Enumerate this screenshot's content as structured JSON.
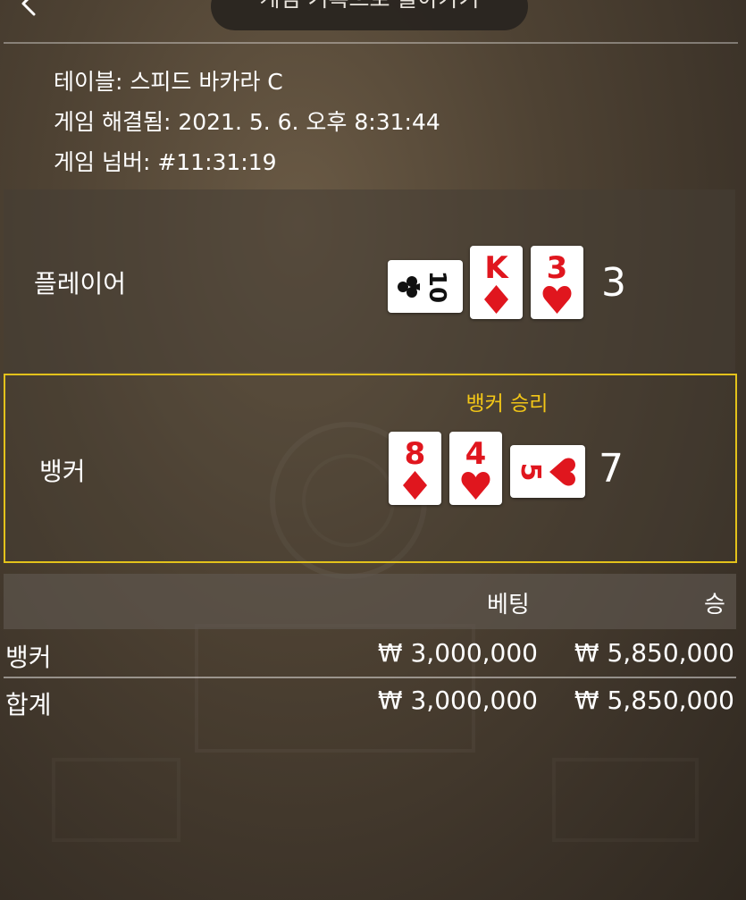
{
  "header": {
    "back_icon": "chevron-left-icon",
    "history_button_label": "게임 기록으로 돌아가기"
  },
  "info": {
    "table": "테이블: 스피드 바카라 C",
    "resolved": "게임 해결됨: 2021. 5. 6. 오후 8:31:44",
    "number": "게임 넘버: #11:31:19"
  },
  "player": {
    "label": "플레이어",
    "score": "3",
    "cards": [
      {
        "rank": "10",
        "suit": "clubs",
        "orientation": "rotated"
      },
      {
        "rank": "K",
        "suit": "diamonds",
        "orientation": "upright"
      },
      {
        "rank": "3",
        "suit": "hearts",
        "orientation": "upright"
      }
    ]
  },
  "banker": {
    "label": "뱅커",
    "score": "7",
    "result": "뱅커 승리",
    "cards": [
      {
        "rank": "8",
        "suit": "diamonds",
        "orientation": "upright"
      },
      {
        "rank": "4",
        "suit": "hearts",
        "orientation": "upright"
      },
      {
        "rank": "5",
        "suit": "hearts",
        "orientation": "rotated"
      }
    ]
  },
  "bets_table": {
    "headers": {
      "bet": "베팅",
      "win": "승"
    },
    "rows": [
      {
        "label": "뱅커",
        "bet": "₩ 3,000,000",
        "win": "₩ 5,850,000"
      },
      {
        "label": "합계",
        "bet": "₩ 3,000,000",
        "win": "₩ 5,850,000"
      }
    ]
  },
  "colors": {
    "highlight_border": "#e3c21b",
    "win_text": "#f2c617",
    "red_suit": "#e0161e",
    "black_suit": "#111111"
  }
}
